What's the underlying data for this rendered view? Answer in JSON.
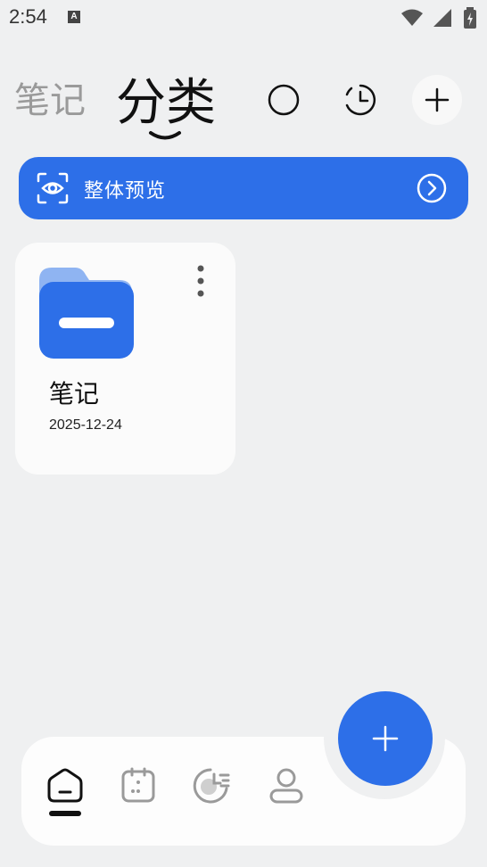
{
  "status_bar": {
    "time": "2:54",
    "notification_letter": "A"
  },
  "header": {
    "tabs": [
      {
        "label": "笔记",
        "active": false
      },
      {
        "label": "分类",
        "active": true
      }
    ],
    "icons": [
      "search-icon",
      "history-icon",
      "add-icon"
    ]
  },
  "preview_banner": {
    "label": "整体预览",
    "icon": "eye-scan-icon",
    "color": "#2d6fe8"
  },
  "folders": [
    {
      "title": "笔记",
      "date": "2025-12-24",
      "icon": "folder-icon",
      "color": "#2d6fe8"
    }
  ],
  "bottom_nav": {
    "items": [
      {
        "icon": "home-icon",
        "active": true
      },
      {
        "icon": "calendar-icon",
        "active": false
      },
      {
        "icon": "timeline-icon",
        "active": false
      },
      {
        "icon": "profile-icon",
        "active": false
      }
    ]
  },
  "fab": {
    "icon": "plus-icon",
    "color": "#2d6fe8"
  }
}
